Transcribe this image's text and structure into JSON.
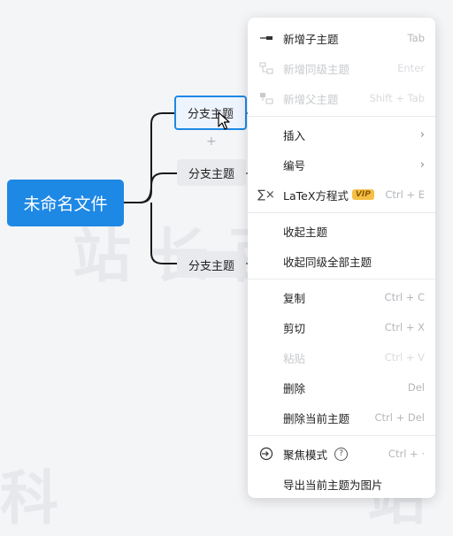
{
  "canvas": {
    "root_topic": "未命名文件",
    "branches": [
      "分支主题",
      "分支主题",
      "分支主题"
    ],
    "add_symbol": "+"
  },
  "menu": {
    "add_child": {
      "label": "新增子主题",
      "shortcut": "Tab"
    },
    "add_sibling": {
      "label": "新增同级主题",
      "shortcut": "Enter"
    },
    "add_parent": {
      "label": "新增父主题",
      "shortcut": "Shift + Tab"
    },
    "insert": {
      "label": "插入",
      "arrow": "›"
    },
    "numbering": {
      "label": "编号",
      "arrow": "›"
    },
    "latex": {
      "label": "LaTeX方程式",
      "badge": "VIP",
      "shortcut": "Ctrl + E",
      "icon_glyph": "∑×"
    },
    "collapse": {
      "label": "收起主题"
    },
    "collapse_all": {
      "label": "收起同级全部主题"
    },
    "copy": {
      "label": "复制",
      "shortcut": "Ctrl + C"
    },
    "cut": {
      "label": "剪切",
      "shortcut": "Ctrl + X"
    },
    "paste": {
      "label": "粘贴",
      "shortcut": "Ctrl + V"
    },
    "delete": {
      "label": "删除",
      "shortcut": "Del"
    },
    "delete_current": {
      "label": "删除当前主题",
      "shortcut": "Ctrl + Del"
    },
    "focus_mode": {
      "label": "聚焦模式",
      "help": "?",
      "shortcut": "Ctrl + ·"
    },
    "export_image": {
      "label": "导出当前主题为图片"
    }
  },
  "watermark": {
    "main": "站长百科",
    "left": "科",
    "right": "站"
  }
}
